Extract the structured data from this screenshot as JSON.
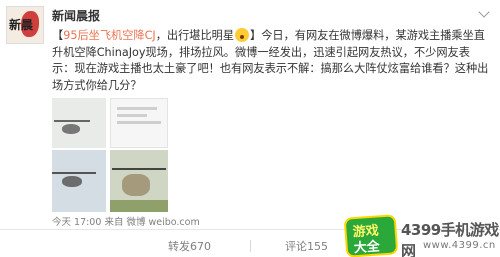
{
  "account": {
    "username": "新闻晨报",
    "avatar_text": "新晨"
  },
  "post": {
    "open_bracket": "【",
    "headline": "95后坐飞机空降CJ",
    "headline_rest": "，出行堪比明星",
    "close_bracket": "】",
    "body": "今日，有网友在微博爆料，某游戏主播乘坐直升机空降ChinaJoy现场，排场拉风。微博一经发出，迅速引起网友热议，不少网友表示：现在游戏主播也太土豪了吧！也有网友表示不解：搞那么大阵仗炫富给谁看？这种出场方式你给几分？",
    "emoji": "surprised-emoji"
  },
  "meta": {
    "time": "今天 17:00",
    "source": "来自 微博 weibo.com"
  },
  "actions": {
    "repost": "转发670",
    "comment": "评论155"
  },
  "watermark": {
    "badge_line1": "游戏",
    "badge_line2": "大全",
    "title": "4399手机游戏网",
    "url": "www.4399.cn"
  },
  "colors": {
    "highlight": "#eb7350",
    "meta_gray": "#808080"
  }
}
